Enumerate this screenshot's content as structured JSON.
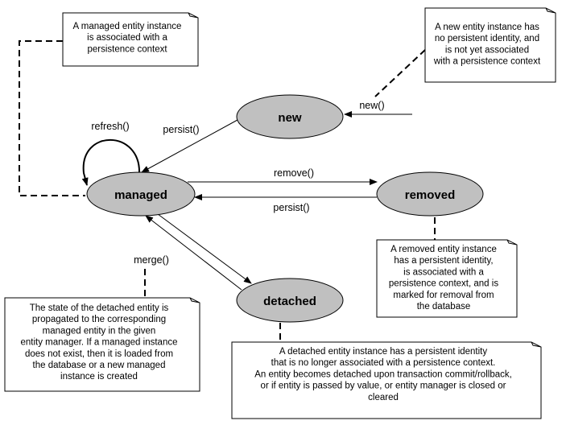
{
  "colors": {
    "state_fill": "#c0c0c0",
    "line": "#000000",
    "background": "#ffffff"
  },
  "states": {
    "new": "new",
    "managed": "managed",
    "removed": "removed",
    "detached": "detached"
  },
  "transitions": {
    "new_call": "new()",
    "persist_new": "persist()",
    "refresh": "refresh()",
    "remove": "remove()",
    "persist_removed": "persist()",
    "merge": "merge()"
  },
  "notes": {
    "managed": [
      "A managed entity instance",
      "is associated with a",
      "persistence context"
    ],
    "new": [
      "A new entity instance has",
      "no persistent identity, and",
      "is not yet associated",
      "with a persistence context"
    ],
    "removed": [
      "A removed entity instance",
      "has a persistent identity,",
      "is associated with a",
      "persistence context, and is",
      "marked for removal from",
      "the database"
    ],
    "merge": [
      "The state of the detached entity is",
      "propagated to the corresponding",
      "managed entity in the given",
      "entity manager. If a managed instance",
      "does not exist, then it is loaded from",
      "the database or a new managed",
      "instance is created"
    ],
    "detached": [
      "A detached entity instance has a persistent identity",
      "that is no longer associated with a persistence context.",
      "An entity becomes detached upon transaction commit/rollback,",
      "or if entity is passed by value, or entity manager is closed or",
      "cleared"
    ]
  }
}
